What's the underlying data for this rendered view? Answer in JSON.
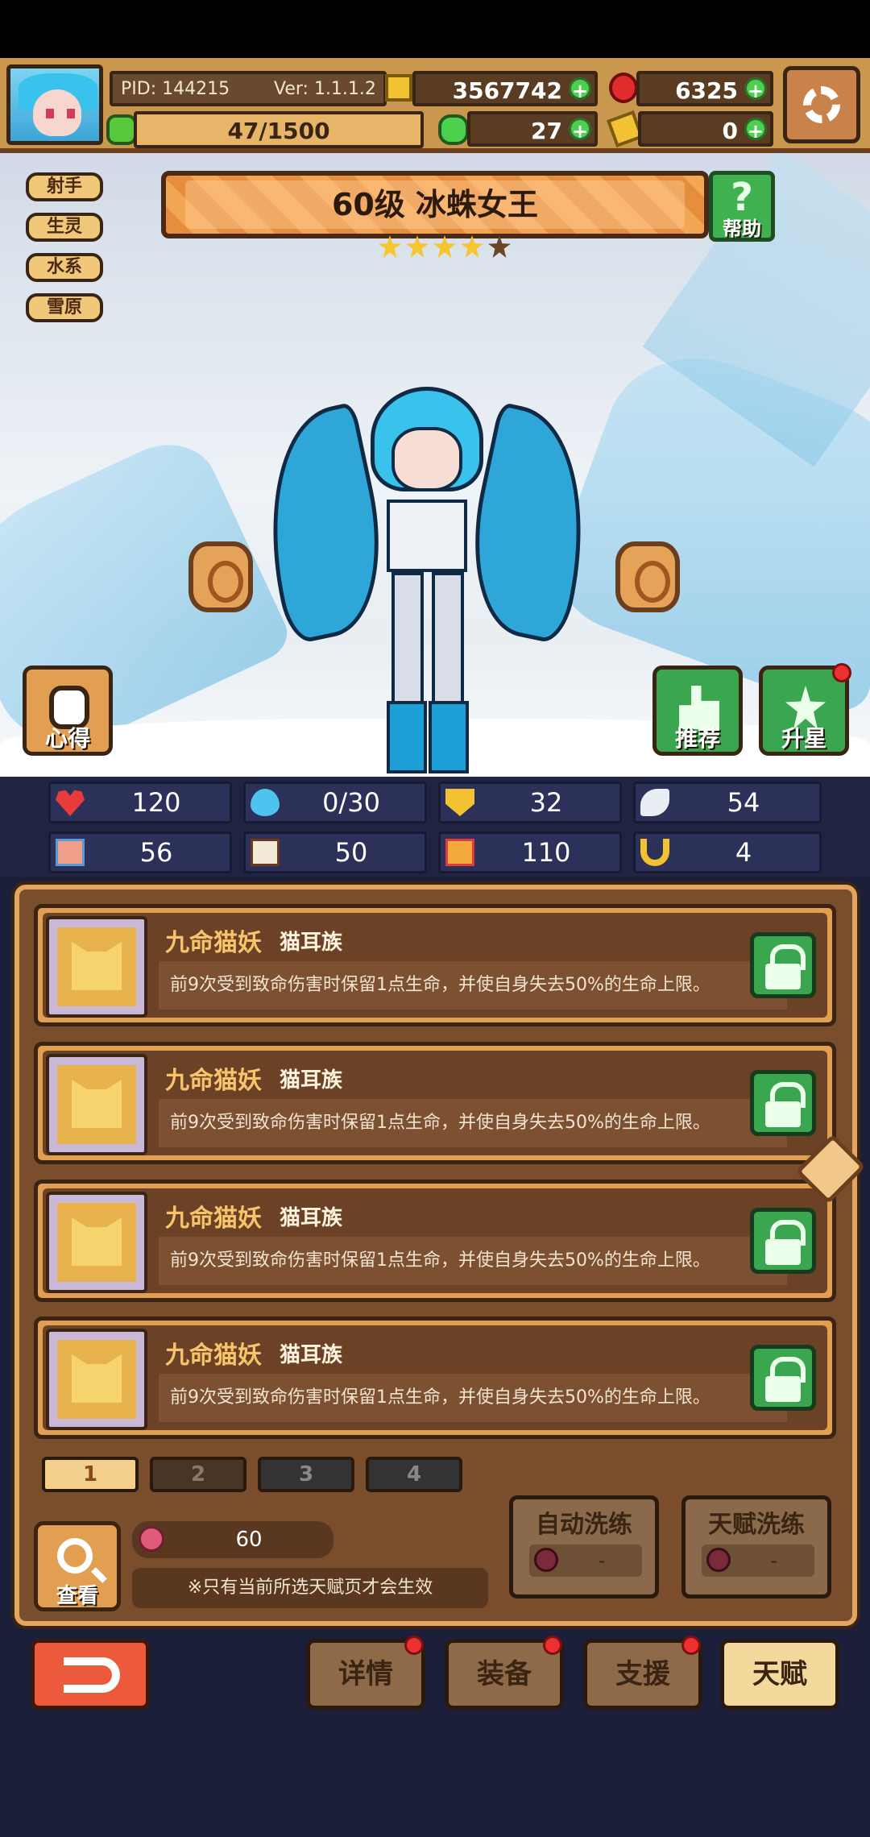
{
  "header": {
    "pid": "PID: 144215",
    "version": "Ver: 1.1.1.2",
    "gold": "3567742",
    "gems": "6325",
    "stamina": "47/1500",
    "clover": "27",
    "key": "0"
  },
  "tags": [
    "射手",
    "生灵",
    "水系",
    "雪原"
  ],
  "title": "60级  冰蛛女王",
  "help_label": "帮助",
  "help_glyph": "?",
  "stars_filled": 4,
  "stars_total": 5,
  "actions": {
    "notes": "心得",
    "recommend": "推荐",
    "star_up": "升星"
  },
  "stats": [
    {
      "icon": "heart-icon",
      "value": "120"
    },
    {
      "icon": "mana-drop-icon",
      "value": "0/30"
    },
    {
      "icon": "shield-icon",
      "value": "32"
    },
    {
      "icon": "wing-icon",
      "value": "54"
    },
    {
      "icon": "fist-icon",
      "value": "56"
    },
    {
      "icon": "book-icon",
      "value": "50"
    },
    {
      "icon": "boot-icon",
      "value": "110"
    },
    {
      "icon": "magnet-icon",
      "value": "4"
    }
  ],
  "talents": [
    {
      "name": "九命猫妖",
      "tribe": "猫耳族",
      "desc": "前9次受到致命伤害时保留1点生命，并使自身失去50%的生命上限。"
    },
    {
      "name": "九命猫妖",
      "tribe": "猫耳族",
      "desc": "前9次受到致命伤害时保留1点生命，并使自身失去50%的生命上限。"
    },
    {
      "name": "九命猫妖",
      "tribe": "猫耳族",
      "desc": "前9次受到致命伤害时保留1点生命，并使自身失去50%的生命上限。"
    },
    {
      "name": "九命猫妖",
      "tribe": "猫耳族",
      "desc": "前9次受到致命伤害时保留1点生命，并使自身失去50%的生命上限。"
    }
  ],
  "pages": [
    "1",
    "2",
    "3",
    "4"
  ],
  "view_label": "查看",
  "fruit_count": "60",
  "notice": "※只有当前所选天赋页才会生效",
  "auto_wash": {
    "label": "自动洗练",
    "cost": "-"
  },
  "talent_wash": {
    "label": "天赋洗练",
    "cost": "-"
  },
  "nav": {
    "details": "详情",
    "equipment": "装备",
    "support": "支援",
    "talent": "天赋"
  },
  "colors": {
    "accent": "#e29e51",
    "panel": "#7a4e2d",
    "lock_green": "#3aa64f",
    "back_red": "#ec5a3b"
  }
}
